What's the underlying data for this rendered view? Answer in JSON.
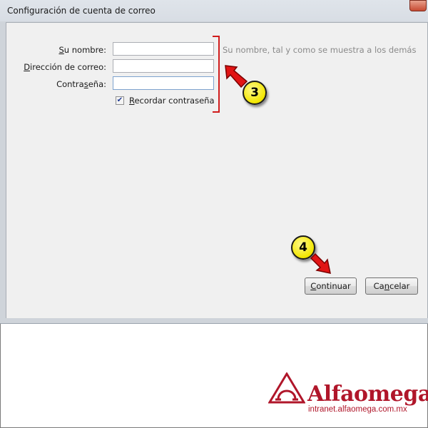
{
  "window": {
    "title": "Configuración de cuenta de correo"
  },
  "form": {
    "name_label_accel": "S",
    "name_label_rest": "u nombre:",
    "email_label_pre": "D",
    "email_label_rest": "irección de correo:",
    "password_label_pre": "Contra",
    "password_label_accel": "s",
    "password_label_rest": "eña:",
    "name_value": "",
    "email_value": "",
    "password_value": "",
    "name_hint": "Su nombre, tal y como se muestra a los demás",
    "remember_checked": true,
    "remember_check_glyph": "✔",
    "remember_label_accel": "R",
    "remember_label_rest": "ecordar contraseña"
  },
  "buttons": {
    "continue_accel": "C",
    "continue_rest": "ontinuar",
    "cancel_pre": "Ca",
    "cancel_accel": "n",
    "cancel_rest": "celar"
  },
  "callouts": {
    "step3": "3",
    "step4": "4"
  },
  "colors": {
    "annotation_red": "#d01c1c",
    "callout_yellow": "#f2e600",
    "brand_red": "#b0162a"
  },
  "logo": {
    "brand": "Alfaomega",
    "url": "intranet.alfaomega.com.mx"
  }
}
